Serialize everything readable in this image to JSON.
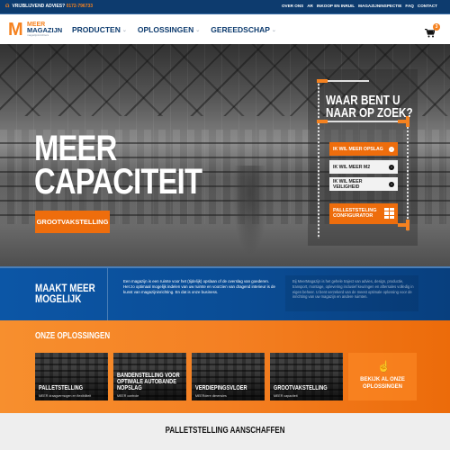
{
  "topbar": {
    "advice_label": "VRIJBLIJVEND ADVIES?",
    "phone": "0172-796733",
    "links": [
      "OVER ONS",
      "AR",
      "INKOOP EN INRUIL",
      "MAGAZIJNINSPECTIE",
      "FAQ",
      "CONTACT"
    ]
  },
  "header": {
    "logo": {
      "meer": "MEER",
      "magazijn": "MAGAZIJN",
      "tagline": "magazijninrichters"
    },
    "nav": [
      "PRODUCTEN",
      "OPLOSSINGEN",
      "GEREEDSCHAP"
    ],
    "cart_count": "3"
  },
  "hero": {
    "title_line1": "MEER",
    "title_line2": "CAPACITEIT",
    "cta": "GROOTVAKSTELLING",
    "panel": {
      "title_line1": "WAAR BENT U",
      "title_line2": "NAAR OP ZOEK?",
      "choices": [
        "IK WIL MEER OPSLAG",
        "IK WIL MEER M2",
        "IK WIL MEER VEILIGHEID"
      ],
      "configurator_line1": "PALLESTSTELING",
      "configurator_line2": "CONFIGURATOR"
    }
  },
  "intro": {
    "title_line1": "MAAKT MEER",
    "title_line2": "MOGELIJK",
    "paragraph1": "Een magazijn is een ruimte voor het (tijdelijk) opslaan of de overslag van goederen. Het zo optimaal mogelijk indelen van uw ruimte en voorzien van dragend interieur is de kunst van magazijninrichting. En dat is onze business.",
    "paragraph2": "Bij MeerMagazijn is het gehele traject van advies, design, productie, transport, montage, oplevering inclusief keuringen en aftersales volledig in eigen beheer. U bent verzekerd van de meest optimale oplossing voor de inrichting van uw magazijn en andere ruimten."
  },
  "solutions": {
    "title": "ONZE OPLOSSINGEN",
    "cards": [
      {
        "title": "PALLETSTELLING",
        "subtitle": "MEER draagvermogen en flexibiliteit"
      },
      {
        "title_lines": [
          "BANDENSTELLING VOOR",
          "OPTIMALE AUTOBANDE",
          "NOPSLAG"
        ],
        "subtitle": "MEER controle"
      },
      {
        "title": "VERDIEPINGSVLOER",
        "subtitle": "MEERdere dimensies"
      },
      {
        "title": "GROOTVAKSTELLING",
        "subtitle": "MEER capaciteit"
      }
    ],
    "see_all_line1": "BEKIJK AL ONZE",
    "see_all_line2": "OPLOSSINGEN"
  },
  "bottom": {
    "title": "PALLETSTELLING AANSCHAFFEN"
  },
  "colors": {
    "navy": "#0d3b6e",
    "orange": "#f58220",
    "blue": "#0c56a6"
  }
}
